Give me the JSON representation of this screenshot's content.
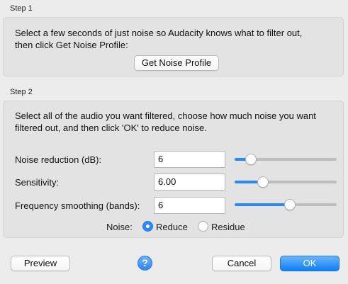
{
  "step1": {
    "title": "Step 1",
    "description": "Select a few seconds of just noise so Audacity knows what to filter out,\nthen click Get Noise Profile:",
    "get_profile_label": "Get Noise Profile"
  },
  "step2": {
    "title": "Step 2",
    "description": "Select all of the audio you want filtered, choose how much noise you want\nfiltered out, and then click 'OK' to reduce noise.",
    "params": [
      {
        "label": "Noise reduction (dB):",
        "value": "6",
        "slider_fraction": 0.16
      },
      {
        "label": "Sensitivity:",
        "value": "6.00",
        "slider_fraction": 0.28
      },
      {
        "label": "Frequency smoothing (bands):",
        "value": "6",
        "slider_fraction": 0.54
      }
    ],
    "noise": {
      "label": "Noise:",
      "options": [
        {
          "label": "Reduce",
          "selected": true
        },
        {
          "label": "Residue",
          "selected": false
        }
      ]
    }
  },
  "footer": {
    "preview_label": "Preview",
    "help_glyph": "?",
    "cancel_label": "Cancel",
    "ok_label": "OK"
  },
  "colors": {
    "accent": "#2a8af6",
    "background": "#ececec",
    "group_background": "#e3e3e3"
  }
}
